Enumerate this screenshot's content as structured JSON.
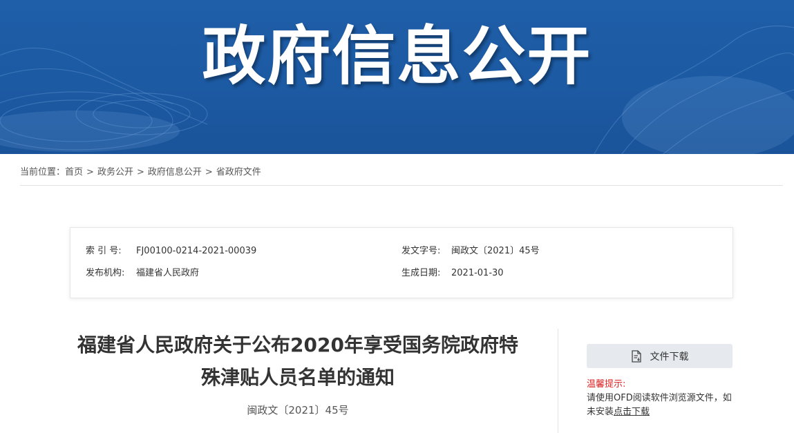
{
  "banner": {
    "title": "政府信息公开"
  },
  "breadcrumb": {
    "prefix": "当前位置：",
    "items": [
      "首页",
      "政务公开",
      "政府信息公开",
      "省政府文件"
    ],
    "separator": ">"
  },
  "meta": {
    "index_label": "索 引 号:",
    "index_value": "FJ00100-0214-2021-00039",
    "issuer_label": "发布机构:",
    "issuer_value": "福建省人民政府",
    "doc_no_label": "发文字号:",
    "doc_no_value": "闽政文〔2021〕45号",
    "date_label": "生成日期:",
    "date_value": "2021-01-30"
  },
  "document": {
    "title_line1": "福建省人民政府关于公布2020年享受国务院政府特",
    "title_line2": "殊津贴人员名单的通知",
    "number": "闽政文〔2021〕45号"
  },
  "download": {
    "button_label": "文件下载",
    "icon": "file-download-icon",
    "tip_title": "温馨提示:",
    "tip_text": "请使用OFD阅读软件浏览源文件，如未安装",
    "tip_link": "点击下载"
  },
  "colors": {
    "banner_blue": "#1c5aa3",
    "tip_red": "#dd2222",
    "button_bg": "#e6eaef"
  }
}
